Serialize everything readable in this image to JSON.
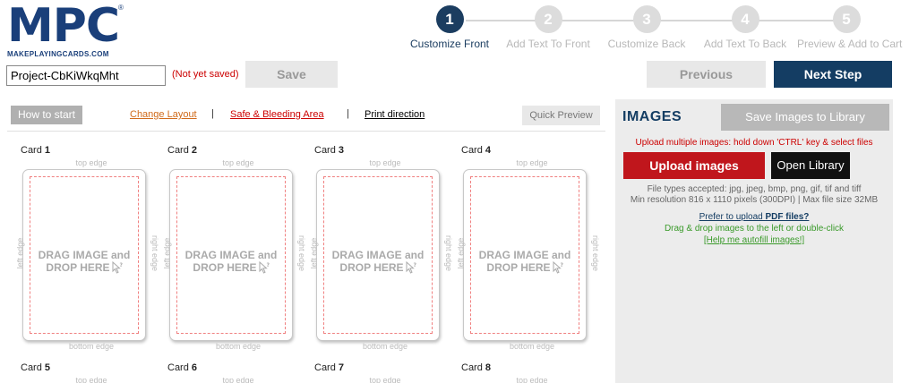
{
  "logo": {
    "brand": "MPC",
    "registered": "®",
    "subtitle": "MAKEPLAYINGCARDS.COM"
  },
  "steps": [
    {
      "number": "1",
      "label": "Customize Front",
      "active": true
    },
    {
      "number": "2",
      "label": "Add Text To Front",
      "active": false
    },
    {
      "number": "3",
      "label": "Customize Back",
      "active": false
    },
    {
      "number": "4",
      "label": "Add Text To Back",
      "active": false
    },
    {
      "number": "5",
      "label": "Preview & Add to Cart",
      "active": false
    }
  ],
  "project": {
    "name_value": "Project-CbKiWkqMht",
    "status": "(Not yet saved)",
    "save_label": "Save"
  },
  "nav": {
    "previous_label": "Previous",
    "next_label": "Next Step"
  },
  "toolbar": {
    "how_to_start": "How to start",
    "change_layout": "Change Layout",
    "separator": "|",
    "safe_bleeding": "Safe & Bleeding Area",
    "print_direction": "Print direction",
    "quick_preview": "Quick Preview"
  },
  "cards": {
    "card_prefix": "Card",
    "top_edge": "top edge",
    "bottom_edge": "bottom edge",
    "left_edge": "left edge",
    "right_edge": "right edge",
    "drag_line1": "DRAG IMAGE and",
    "drag_line2": "DROP HERE",
    "items": [
      {
        "number": "1"
      },
      {
        "number": "2"
      },
      {
        "number": "3"
      },
      {
        "number": "4"
      },
      {
        "number": "5"
      },
      {
        "number": "6"
      },
      {
        "number": "7"
      },
      {
        "number": "8"
      }
    ]
  },
  "images_panel": {
    "title": "IMAGES",
    "save_to_library": "Save Images to Library",
    "upload_hint": "Upload multiple images: hold down 'CTRL' key & select files",
    "upload_button": "Upload images",
    "open_library": "Open Library",
    "file_types": "File types accepted: jpg, jpeg, bmp, png, gif, tif and tiff",
    "min_resolution": "Min resolution 816 x 1110 pixels (300DPI) | Max file size 32MB",
    "prefer_pdf_prefix": "Prefer to upload ",
    "prefer_pdf_bold": "PDF files?",
    "drag_drop_hint": "Drag & drop images to the left or double-click",
    "autofill_help": "[Help me autofill images!]"
  },
  "colors": {
    "brand_navy": "#143d63",
    "upload_red": "#c0161c",
    "warning_red": "#cc0000",
    "hint_green": "#3a9a2a",
    "safe_line": "#f08080"
  }
}
